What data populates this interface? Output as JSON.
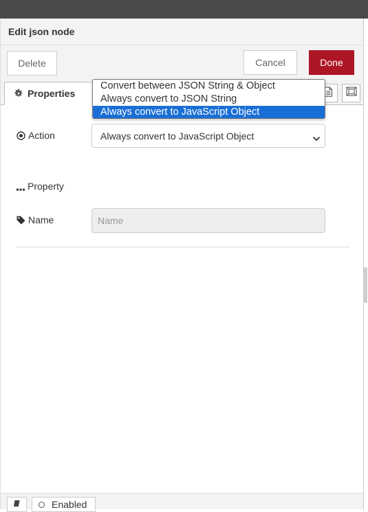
{
  "header": {
    "title": "Edit json node"
  },
  "buttons": {
    "delete": "Delete",
    "cancel": "Cancel",
    "done": "Done"
  },
  "tabs": {
    "properties": "Properties"
  },
  "form": {
    "action_label": "Action",
    "action_value": "Always convert to JavaScript Object",
    "action_options": [
      "Convert between JSON String & Object",
      "Always convert to JSON String",
      "Always convert to JavaScript Object"
    ],
    "property_label": "Property",
    "name_label": "Name",
    "name_placeholder": "Name",
    "name_value": ""
  },
  "footer": {
    "enabled_label": "Enabled"
  },
  "colors": {
    "done": "#ad1625",
    "selected_option": "#1a6fd6"
  },
  "icons": [
    "gear-icon",
    "radio-target-icon",
    "ellipsis-icon",
    "tag-icon",
    "document-icon",
    "frame-icon",
    "book-icon",
    "chevron-down-icon"
  ]
}
